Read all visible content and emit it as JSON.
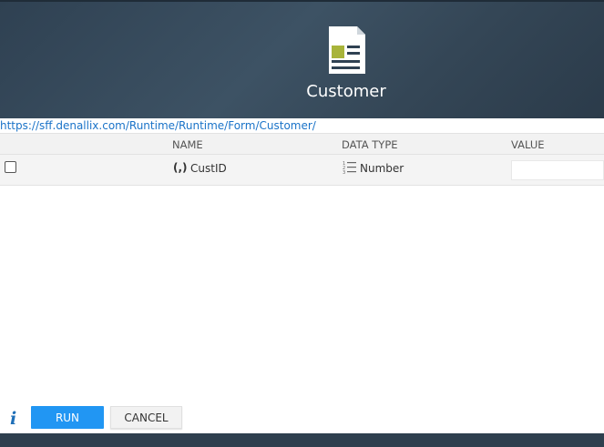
{
  "header": {
    "title": "Customer",
    "icon": "form-document-icon",
    "icon_accent_color": "#a8b43a"
  },
  "url": {
    "text": "https://sff.denallix.com/Runtime/Runtime/Form/Customer/"
  },
  "columns": {
    "name": "NAME",
    "data_type": "DATA TYPE",
    "value": "VALUE"
  },
  "rows": [
    {
      "name_icon_glyph": "(,)",
      "name": "CustID",
      "data_type_icon": "numbered-list-icon",
      "data_type": "Number",
      "value": "",
      "checked": false
    }
  ],
  "actions": {
    "info_glyph": "i",
    "run_label": "RUN",
    "cancel_label": "CANCEL",
    "run_color": "#2196f3"
  }
}
